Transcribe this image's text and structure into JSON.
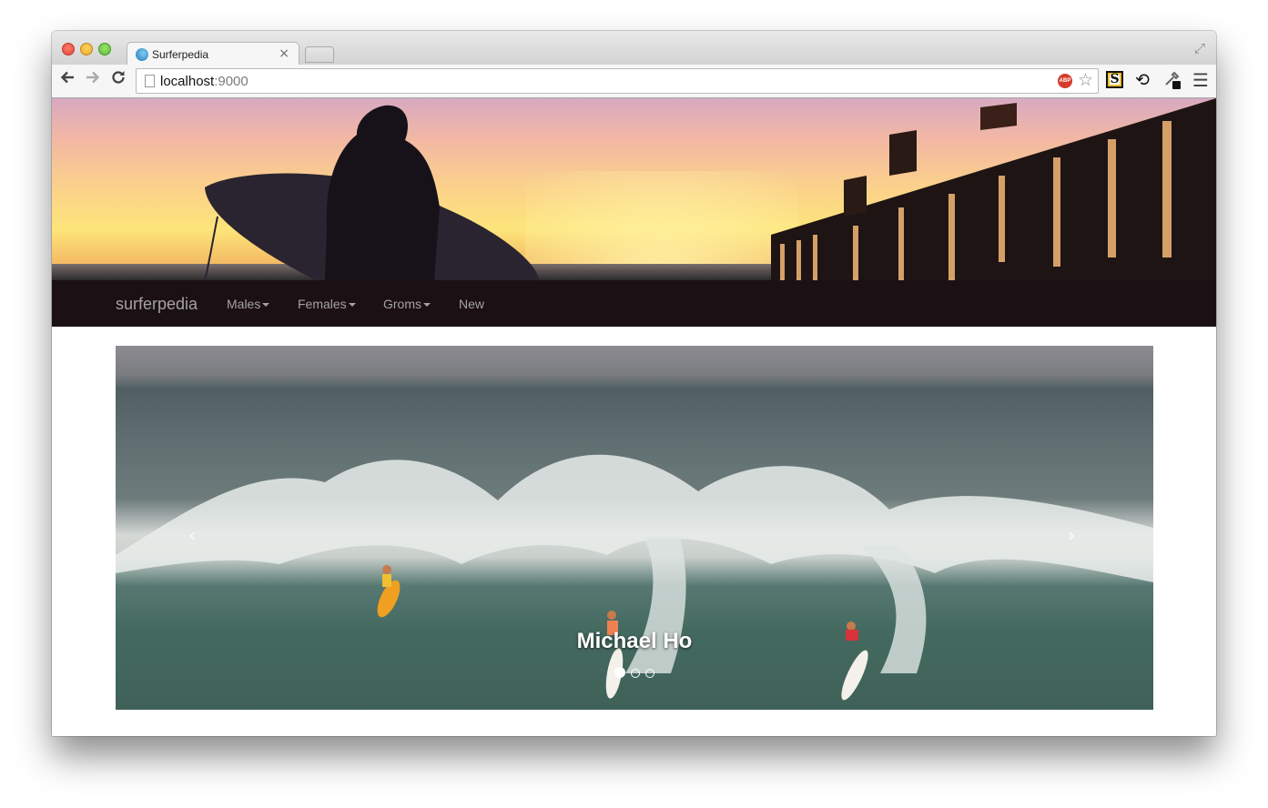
{
  "browser": {
    "tab_title": "Surferpedia",
    "tab_close": "×",
    "url_host": "localhost",
    "url_port": ":9000",
    "icons": {
      "back": "arrow-left-icon",
      "forward": "arrow-right-icon",
      "reload": "reload-icon",
      "bookmark": "star-icon",
      "adblock": "adblock-icon",
      "adblock_text": "ABP",
      "extension_s": "S",
      "sync": "sync-icon",
      "eyedropper": "eyedropper-icon",
      "menu": "hamburger-menu-icon",
      "fullscreen": "fullscreen-icon"
    }
  },
  "navbar": {
    "brand": "surferpedia",
    "items": [
      {
        "label": "Males",
        "dropdown": true
      },
      {
        "label": "Females",
        "dropdown": true
      },
      {
        "label": "Groms",
        "dropdown": true
      },
      {
        "label": "New",
        "dropdown": false
      }
    ],
    "background": "#1b1013",
    "text_color": "#a3a3a3"
  },
  "carousel": {
    "caption": "Michael Ho",
    "slide_count": 3,
    "active_index": 0,
    "prev_glyph": "‹",
    "next_glyph": "›"
  }
}
